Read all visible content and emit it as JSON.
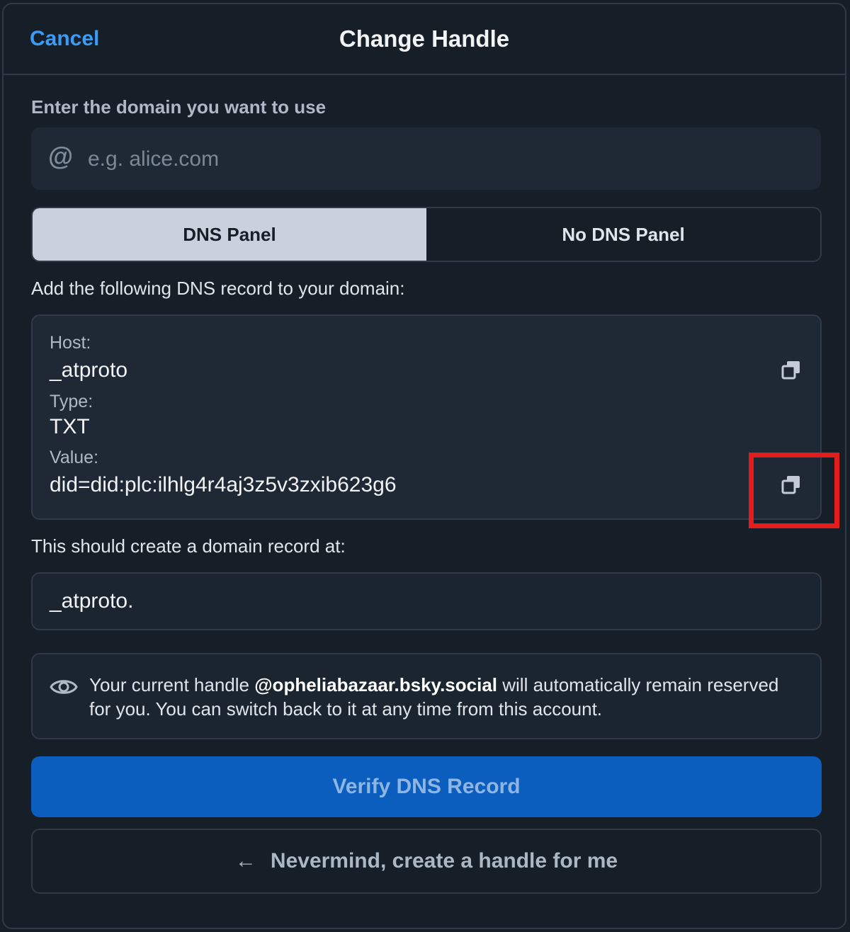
{
  "header": {
    "cancel_label": "Cancel",
    "title": "Change Handle"
  },
  "domain": {
    "label": "Enter the domain you want to use",
    "placeholder": "e.g. alice.com",
    "at_symbol": "@",
    "value": ""
  },
  "segments": {
    "options": [
      "DNS Panel",
      "No DNS Panel"
    ],
    "selected": "DNS Panel"
  },
  "dns_instructions": "Add the following DNS record to your domain:",
  "dns_record": {
    "host_label": "Host:",
    "host_value": "_atproto",
    "type_label": "Type:",
    "type_value": "TXT",
    "value_label": "Value:",
    "value_value": "did=did:plc:ilhlg4r4aj3z5v3zxib623g6"
  },
  "record_at_label": "This should create a domain record at:",
  "record_at_value": "_atproto.",
  "info": {
    "prefix": "Your current handle ",
    "handle": "@opheliabazaar.bsky.social",
    "suffix": " will automatically remain reserved for you. You can switch back to it at any time from this account."
  },
  "buttons": {
    "verify": "Verify DNS Record",
    "nevermind": "Nevermind, create a handle for me",
    "back_arrow": "←"
  },
  "colors": {
    "background": "#161e27",
    "accent": "#3a9cf7",
    "primary_button": "#0b5ebd",
    "highlight": "#e41c1c"
  },
  "icons": [
    "at-icon",
    "copy-icon",
    "eye-icon",
    "arrow-left-icon"
  ]
}
